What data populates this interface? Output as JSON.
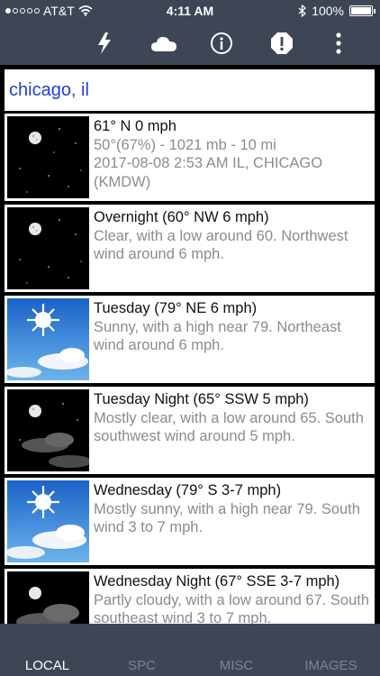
{
  "status_bar": {
    "carrier": "AT&T",
    "time": "4:11 AM",
    "battery": "100%"
  },
  "toolbar": {
    "icons": [
      "lightning-icon",
      "cloud-icon",
      "info-icon",
      "alert-icon",
      "more-vertical-icon"
    ]
  },
  "search": {
    "location": "chicago, il"
  },
  "current": {
    "line1": "61° N 0 mph",
    "line2": "50°(67%) - 1021 mb - 10 mi",
    "line3": "2017-08-08 2:53 AM IL, CHICAGO",
    "line4": "(KMDW)"
  },
  "forecast": [
    {
      "title": "Overnight (60° NW 6 mph)",
      "desc": "Clear, with a low around 60. Northwest wind around 6 mph.",
      "icon": "night-clear"
    },
    {
      "title": "Tuesday (79° NE 6 mph)",
      "desc": "Sunny, with a high near 79. Northeast wind around 6 mph.",
      "icon": "day-sunny"
    },
    {
      "title": "Tuesday Night (65° SSW 5 mph)",
      "desc": "Mostly clear, with a low around 65. South southwest wind around 5 mph.",
      "icon": "night-mostly-clear"
    },
    {
      "title": "Wednesday (79° S 3-7 mph)",
      "desc": "Mostly sunny, with a high near 79. South wind 3 to 7 mph.",
      "icon": "day-mostly-sunny"
    },
    {
      "title": "Wednesday Night (67° SSE 3-7 mph)",
      "desc": "Partly cloudy, with a low around 67. South southeast wind 3 to 7 mph.",
      "icon": "night-partly-cloudy"
    }
  ],
  "tabs": {
    "local": "LOCAL",
    "spc": "SPC",
    "misc": "MISC",
    "images": "IMAGES"
  },
  "colors": {
    "bar": "#3d4654",
    "link": "#1d3fe0",
    "desc": "#8c8c8c"
  }
}
